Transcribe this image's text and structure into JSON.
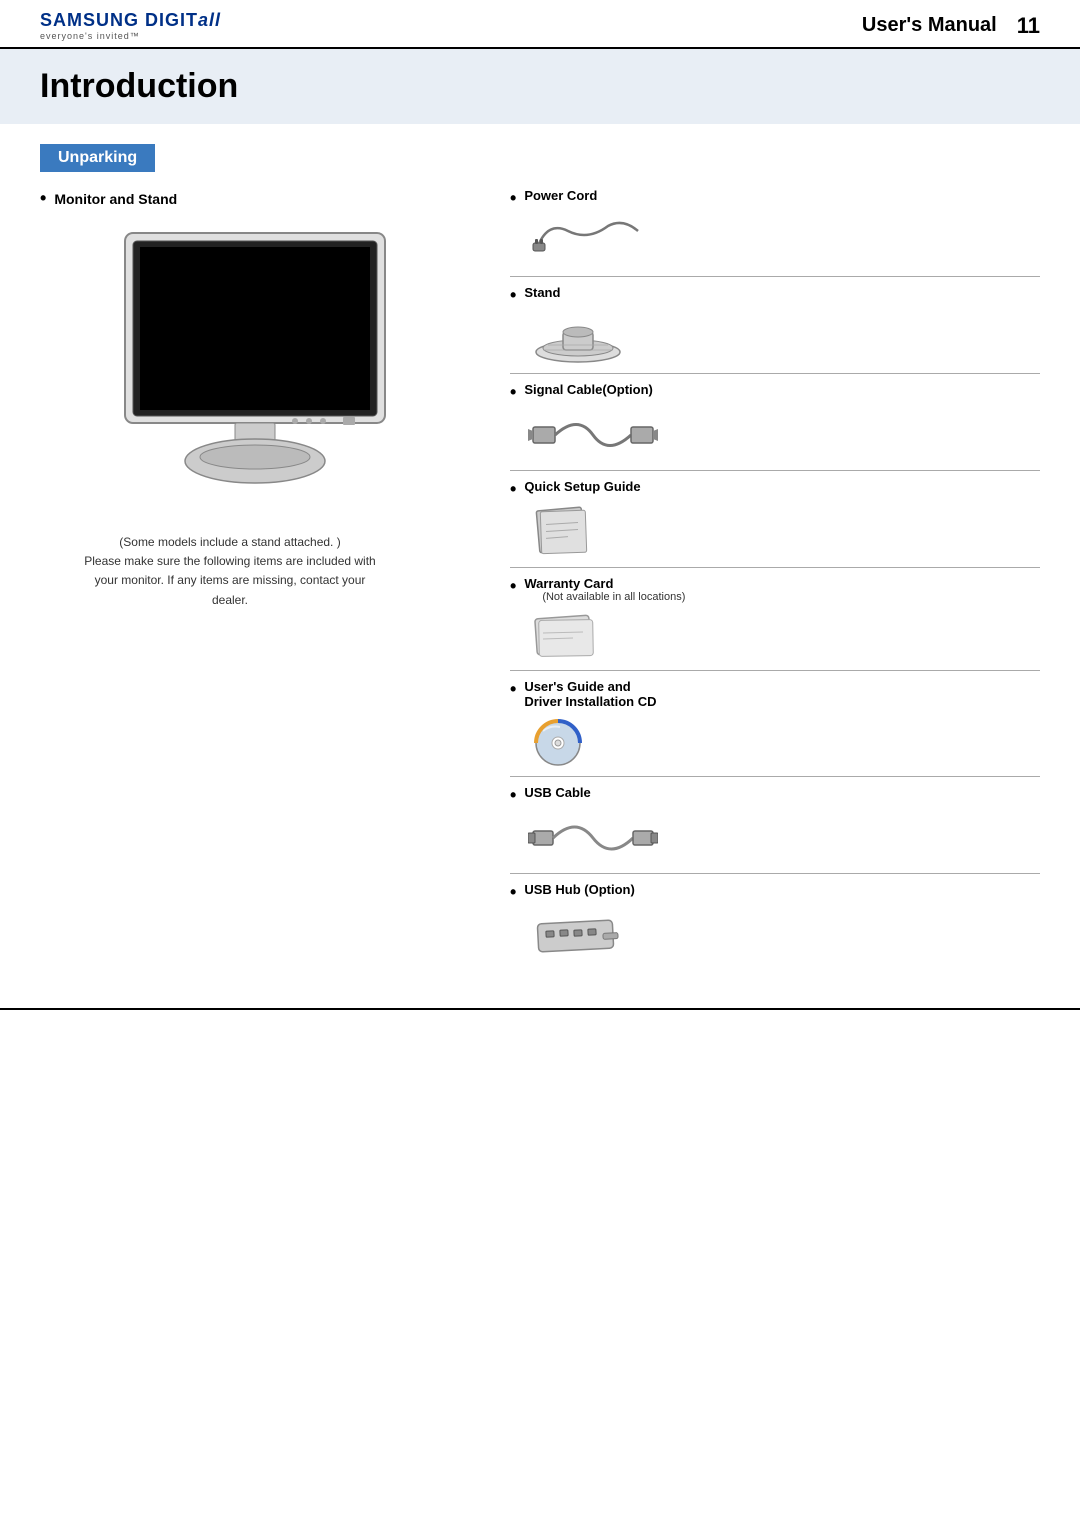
{
  "header": {
    "brand_name": "SAMSUNG DIGIT",
    "brand_italic": "all",
    "tagline": "everyone's invited™",
    "manual_title": "User's Manual",
    "page_number": "11"
  },
  "page": {
    "title": "Introduction",
    "section_label": "Unparking"
  },
  "left_column": {
    "item_label": "Monitor and Stand",
    "caption_line1": "(Some models include a stand attached. )",
    "caption_line2": "Please make sure the following items are included with",
    "caption_line3": "your monitor. If any items are missing, contact your",
    "caption_line4": "dealer."
  },
  "right_column": {
    "items": [
      {
        "id": "power-cord",
        "label": "Power Cord",
        "sublabel": ""
      },
      {
        "id": "stand",
        "label": "Stand",
        "sublabel": ""
      },
      {
        "id": "signal-cable",
        "label": "Signal Cable(Option)",
        "sublabel": ""
      },
      {
        "id": "quick-setup-guide",
        "label": "Quick Setup Guide",
        "sublabel": ""
      },
      {
        "id": "warranty-card",
        "label": "Warranty Card",
        "sublabel": "(Not available in all locations)"
      },
      {
        "id": "users-guide-cd",
        "label": "User's Guide and",
        "label2": "Driver Installation CD",
        "sublabel": ""
      },
      {
        "id": "usb-cable",
        "label": "USB Cable",
        "sublabel": ""
      },
      {
        "id": "usb-hub",
        "label": "USB Hub (Option)",
        "sublabel": ""
      }
    ]
  }
}
